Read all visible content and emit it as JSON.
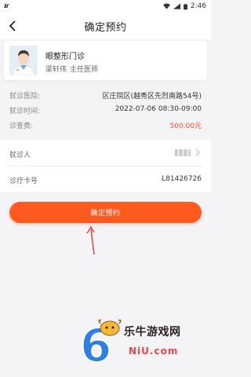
{
  "status_bar": {
    "left_glyph": "ʁ",
    "time": "2:46"
  },
  "nav": {
    "title": "确定预约"
  },
  "doctor": {
    "department": "眼整形门诊",
    "name": "梁轩伟",
    "title": "主任医师"
  },
  "info": [
    {
      "label": "就诊医院:",
      "value": "区庄院区(越秀区先烈南路54号)"
    },
    {
      "label": "就诊时间:",
      "value": "2022-07-06 08:30-09:00"
    },
    {
      "label": "诊查费:",
      "value": "500.00元"
    }
  ],
  "form": {
    "patient_label": "就诊人",
    "card_label": "诊疗卡号",
    "card_value": "L81426726"
  },
  "confirm_button": "确定预约",
  "watermark": {
    "brand": "乐牛游戏网",
    "domain": "NiU.com"
  },
  "colors": {
    "accent": "#ff5a1f",
    "fee": "#ff4b2b",
    "background": "#f4f4f6"
  }
}
